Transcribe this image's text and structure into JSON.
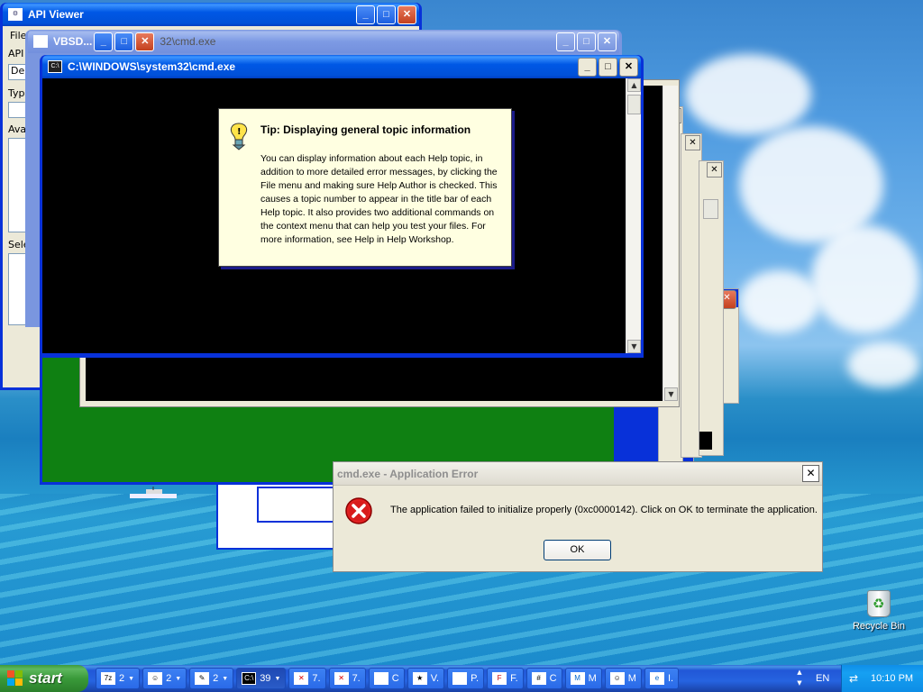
{
  "windows": {
    "api_viewer": {
      "title": "API Viewer",
      "menu_fragment": "File",
      "row_labels": [
        "API",
        "De",
        "Typ",
        "Ava",
        "Sele"
      ]
    },
    "vbsd": {
      "title": "VBSD...",
      "title_tail": "32\\cmd.exe"
    },
    "cmd_front": {
      "title": "C:\\WINDOWS\\system32\\cmd.exe",
      "icon": "cmd-icon"
    },
    "background_fragment": "s"
  },
  "tooltip": {
    "title": "Tip: Displaying general topic information",
    "body": "You can display information about each Help topic, in addition to more detailed error messages, by clicking the File menu and making sure Help Author is checked. This causes a topic number to appear in the title bar of each Help topic. It also provides two additional commands on the context menu that can help you test your files. For more information, see Help in Help Workshop."
  },
  "error_dialog": {
    "title": "cmd.exe - Application Error",
    "message": "The application failed to initialize properly (0xc0000142). Click on OK to terminate the application.",
    "ok_label": "OK"
  },
  "desktop": {
    "recycle_bin_label": "Recycle Bin"
  },
  "taskbar": {
    "start_label": "start",
    "tasks": [
      {
        "icon": "7z-icon",
        "label": "2",
        "group": true
      },
      {
        "icon": "people-icon",
        "label": "2",
        "group": true
      },
      {
        "icon": "tool-icon",
        "label": "2",
        "group": true
      },
      {
        "icon": "cmd-icon",
        "label": "39",
        "group": true,
        "active": true
      },
      {
        "icon": "error-icon",
        "label": "7."
      },
      {
        "icon": "error-icon",
        "label": "7."
      },
      {
        "icon": "window-icon",
        "label": "C"
      },
      {
        "icon": "app-icon",
        "label": "V."
      },
      {
        "icon": "window-icon",
        "label": "P."
      },
      {
        "icon": "app-icon",
        "label": "F."
      },
      {
        "icon": "calc-icon",
        "label": "C"
      },
      {
        "icon": "app-icon",
        "label": "M"
      },
      {
        "icon": "people-icon",
        "label": "M"
      },
      {
        "icon": "app-icon",
        "label": "I."
      }
    ],
    "language": "EN",
    "clock": "10:10 PM"
  }
}
